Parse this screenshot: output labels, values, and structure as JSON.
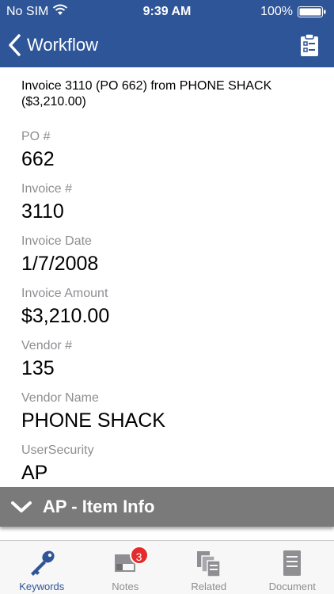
{
  "status_bar": {
    "carrier": "No SIM",
    "time": "9:39 AM",
    "battery": "100%"
  },
  "nav": {
    "back_label": "Workflow"
  },
  "document": {
    "title": "Invoice 3110 (PO 662) from PHONE SHACK ($3,210.00)",
    "fields": [
      {
        "label": "PO #",
        "value": "662"
      },
      {
        "label": "Invoice #",
        "value": "3110"
      },
      {
        "label": "Invoice Date",
        "value": "1/7/2008"
      },
      {
        "label": "Invoice Amount",
        "value": "$3,210.00"
      },
      {
        "label": "Vendor #",
        "value": "135"
      },
      {
        "label": "Vendor Name",
        "value": "PHONE SHACK"
      },
      {
        "label": "UserSecurity",
        "value": "AP"
      }
    ]
  },
  "section": {
    "label": "AP - Item Info"
  },
  "tabs": [
    {
      "label": "Keywords",
      "icon": "key-icon",
      "active": true
    },
    {
      "label": "Notes",
      "icon": "note-icon",
      "badge": "3"
    },
    {
      "label": "Related",
      "icon": "related-documents-icon"
    },
    {
      "label": "Document",
      "icon": "document-icon"
    }
  ],
  "colors": {
    "nav_background": "#2e5597",
    "section_background": "#7a7a7a",
    "badge": "#e52b2b"
  }
}
